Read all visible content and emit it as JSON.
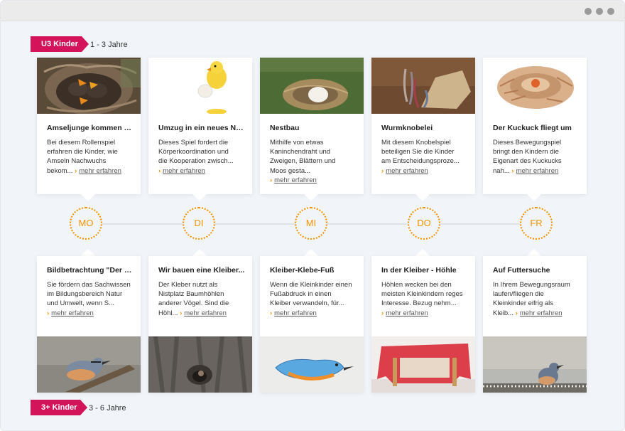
{
  "colors": {
    "accent": "#f39200",
    "tag": "#d4145a"
  },
  "u3": {
    "tag": "U3 Kinder",
    "age": "1 - 3 Jahre"
  },
  "kids3": {
    "tag": "3+ Kinder",
    "age": "3 - 6 Jahre"
  },
  "more_label": "mehr erfahren",
  "days": [
    "MO",
    "DI",
    "MI",
    "DO",
    "FR"
  ],
  "top_cards": [
    {
      "title": "Amseljunge kommen z...",
      "lines": [
        "Bei diesem Rollenspiel",
        "erfahren die Kinder, wie",
        "Amseln Nachwuchs",
        "bekom..."
      ]
    },
    {
      "title": "Umzug in ein neues Nest",
      "lines": [
        "Dieses Spiel fordert die",
        "Körperkoordination und",
        "die Kooperation zwisch..."
      ]
    },
    {
      "title": "Nestbau",
      "lines": [
        "Mithilfe von etwas",
        "Kaninchendraht und",
        "Zweigen, Blättern und",
        "Moos gesta..."
      ]
    },
    {
      "title": "Wurmknobelei",
      "lines": [
        "Mit diesem Knobelspiel",
        "beteiligen Sie die Kinder",
        "am Entscheidungsproze..."
      ]
    },
    {
      "title": "Der Kuckuck fliegt um",
      "lines": [
        "Dieses Bewegungspiel",
        "bringt den Kindern die",
        "Eigenart des Kuckucks",
        "nah..."
      ]
    }
  ],
  "bottom_cards": [
    {
      "title": "Bildbetrachtung \"Der K...",
      "lines": [
        "Sie fördern das Sachwissen",
        "im Bildungsbereich Natur",
        "und Umwelt, wenn S..."
      ]
    },
    {
      "title": "Wir bauen eine Kleiber...",
      "lines": [
        "Der Kleber nutzt als",
        "Nistplatz Baumhöhlen",
        "anderer Vögel. Sind die",
        "Höhl..."
      ]
    },
    {
      "title": "Kleiber-Klebe-Fuß",
      "lines": [
        "Wenn die Kleinkinder einen",
        "Fußabdruck in einen",
        "Kleiber verwandeln, für..."
      ]
    },
    {
      "title": "In der Kleiber - Höhle",
      "lines": [
        "Höhlen wecken bei den",
        "meisten Kleinkindern reges",
        "Interesse. Bezug nehm..."
      ]
    },
    {
      "title": "Auf Futtersuche",
      "lines": [
        "In Ihrem Bewegungsraum",
        "laufen/fliegen die",
        "Kleinkinder eifrig als",
        "Kleib..."
      ]
    }
  ]
}
